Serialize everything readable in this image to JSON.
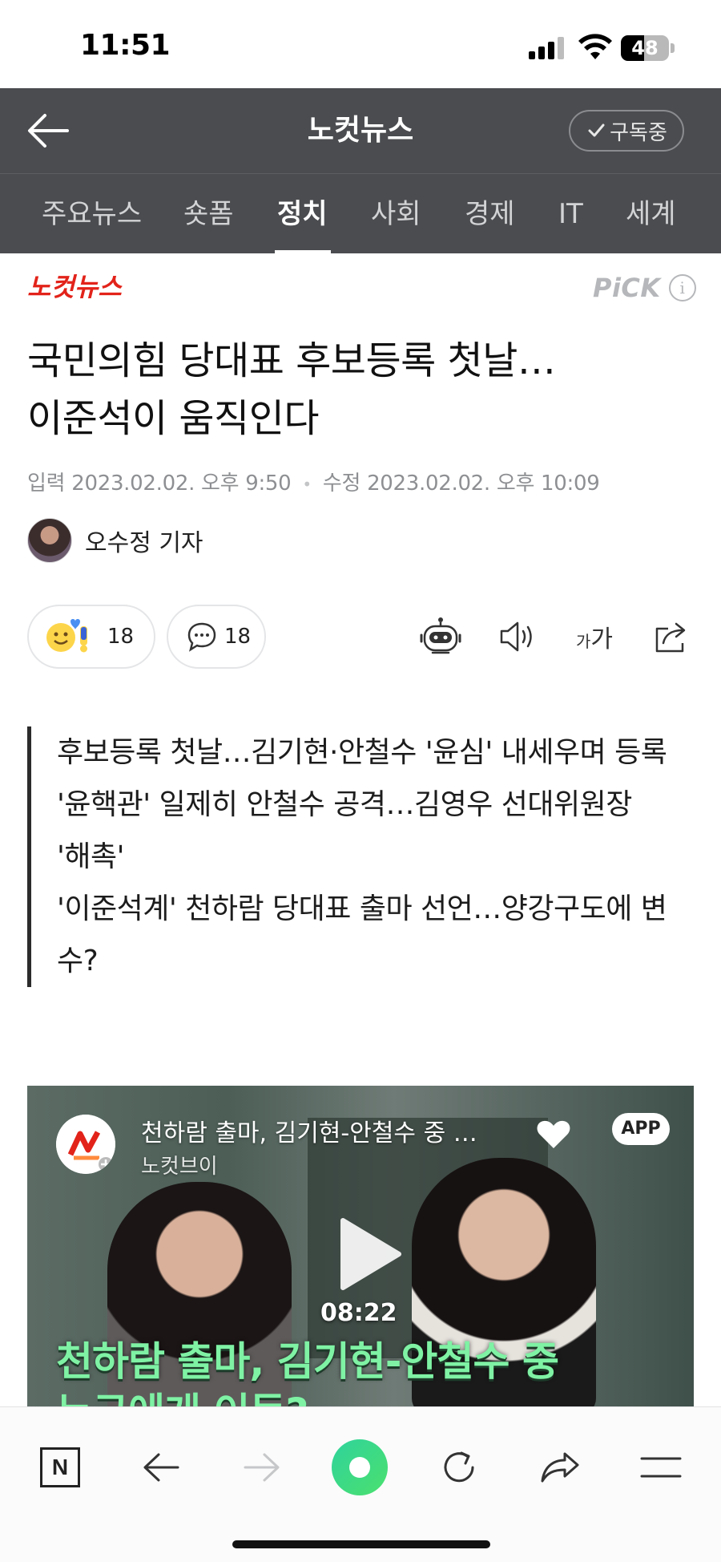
{
  "status_bar": {
    "time": "11:51",
    "battery": "48",
    "battery_level": 0.48
  },
  "header": {
    "back_label": "뒤로",
    "title": "노컷뉴스",
    "subscribe_label": "구독중"
  },
  "tabs": [
    {
      "label": "주요뉴스",
      "active": false
    },
    {
      "label": "숏폼",
      "active": false
    },
    {
      "label": "정치",
      "active": true
    },
    {
      "label": "사회",
      "active": false
    },
    {
      "label": "경제",
      "active": false
    },
    {
      "label": "IT",
      "active": false
    },
    {
      "label": "세계",
      "active": false
    }
  ],
  "article": {
    "press_logo_text": "노컷뉴스",
    "pick_label": "PiCK",
    "pick_info": "i",
    "title_line1": "국민의힘 당대표 후보등록 첫날…",
    "title_line2": "이준석이 움직인다",
    "input_label": "입력",
    "input_time": "2023.02.02. 오후 9:50",
    "edit_label": "수정",
    "edit_time": "2023.02.02. 오후 10:09",
    "reporter": "오수정 기자"
  },
  "actions": {
    "reaction_count": "18",
    "comment_count": "18",
    "font_small": "가",
    "font_large": "가"
  },
  "summary": [
    "후보등록 첫날…김기현·안철수 '윤심' 내세우며 등록",
    "'윤핵관' 일제히 안철수 공격…김영우 선대위원장 '해촉'",
    "'이준석계' 천하람 당대표 출마 선언…양강구도에 변수?"
  ],
  "video": {
    "title": "천하람 출마, 김기현-안철수 중 누구에게 이득?",
    "channel": "노컷브이",
    "app_badge": "APP",
    "duration": "08:22",
    "caption_line1": "천하람 출마, 김기현-안철수 중",
    "caption_line2": "누구에게 이득?"
  },
  "colors": {
    "header_bg": "#4a4c4f",
    "brand_red": "#e2231a",
    "caption_green": "#7ff2a4",
    "nav_green": "#2fd39c"
  },
  "icons": {
    "back": "arrow-left-icon",
    "subscribe_check": "check-icon",
    "reaction": "emoji-reaction-icon",
    "comment": "speech-bubble-icon",
    "summary_bot": "robot-icon",
    "tts": "speaker-icon",
    "font": "font-size-icon",
    "share": "share-icon",
    "nav_home": "naver-n-icon",
    "nav_back": "arrow-left-icon",
    "nav_forward": "arrow-right-icon",
    "nav_green": "green-dot-icon",
    "nav_refresh": "refresh-icon",
    "nav_share": "share-arrow-icon",
    "nav_menu": "menu-icon"
  }
}
